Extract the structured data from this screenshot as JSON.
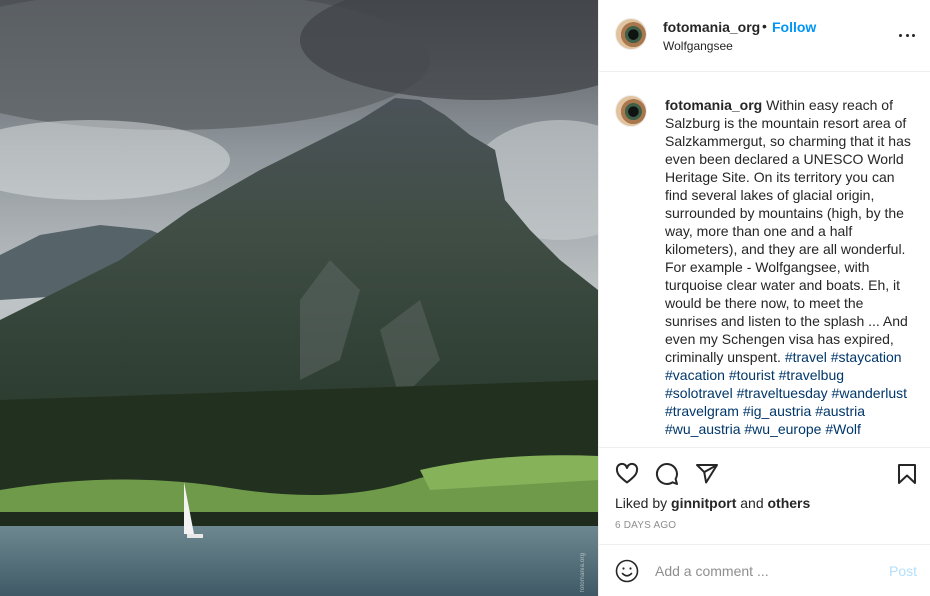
{
  "post": {
    "username": "fotomania_org",
    "separator": "•",
    "follow_label": "Follow",
    "location": "Wolfgangsee",
    "more_icon": "more-options-icon"
  },
  "caption": {
    "username": "fotomania_org",
    "text": "Within easy reach of Salzburg is the mountain resort area of Salzkammergut, so charming that it has even been declared a UNESCO World Heritage Site. On its territory you can find several lakes of glacial origin, surrounded by mountains (high, by the way, more than one and a half kilometers), and they are all wonderful. For example - Wolfgangsee, with turquoise clear water and boats. Eh, it would be there now, to meet the sunrises and listen to the splash ... And even my Schengen visa has expired, criminally unspent.",
    "hashtags": [
      "#travel",
      "#staycation",
      "#vacation",
      "#tourist",
      "#travelbug",
      "#solotravel",
      "#traveltuesday",
      "#wanderlust",
      "#travelgram",
      "#ig_austria",
      "#austria",
      "#wu_austria",
      "#wu_europe",
      "#Wolf"
    ]
  },
  "actions": {
    "like_icon": "heart-icon",
    "comment_icon": "comment-icon",
    "share_icon": "paper-plane-icon",
    "save_icon": "bookmark-icon"
  },
  "likes": {
    "prefix": "Liked by",
    "user": "ginnitport",
    "connector": "and",
    "others": "others"
  },
  "date": "6 DAYS AGO",
  "comment": {
    "placeholder": "Add a comment ...",
    "post_label": "Post",
    "emoji_icon": "smiley-icon"
  },
  "photo": {
    "watermark": "fotomania.org"
  },
  "colors": {
    "link_blue": "#0095f6",
    "hashtag": "#00376b",
    "post_disabled": "#b2dffc",
    "muted": "#8e8e8e"
  }
}
